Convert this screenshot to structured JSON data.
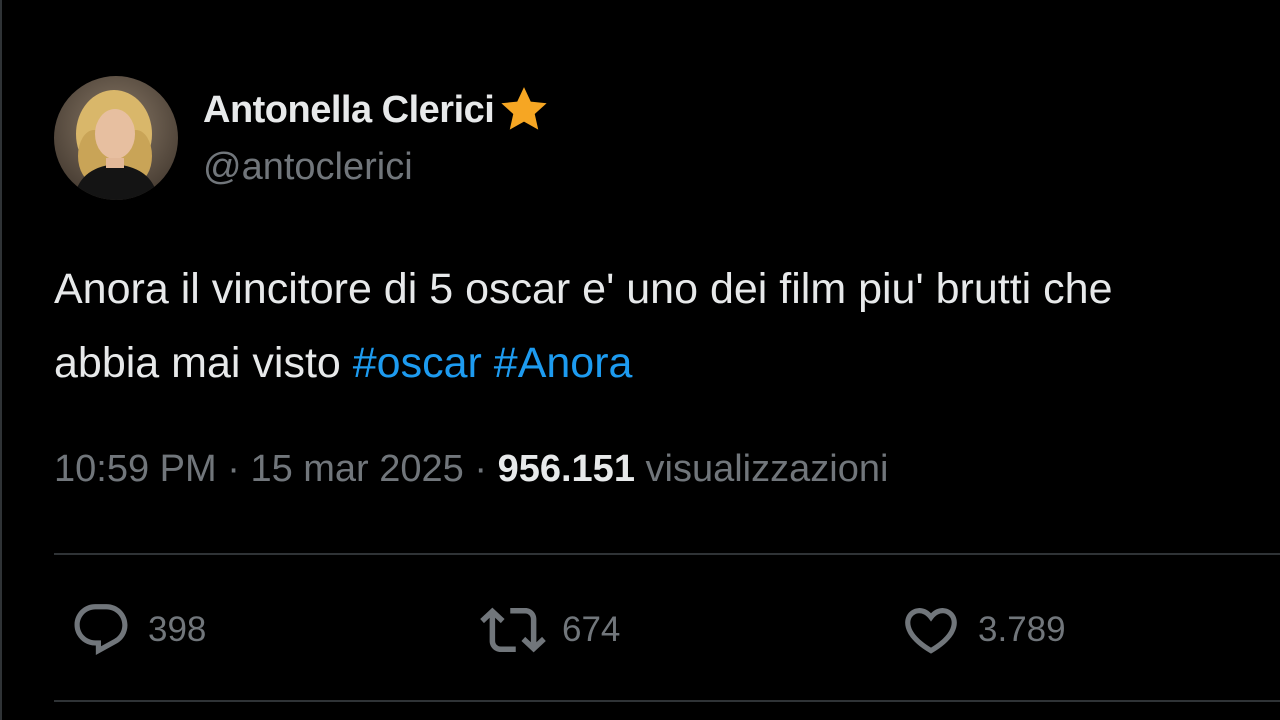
{
  "tweet": {
    "author": {
      "display_name": "Antonella Clerici",
      "handle": "@antoclerici",
      "badge_icon": "star-icon",
      "badge_color": "#f6a623"
    },
    "text_line_1": "Anora il vincitore di 5 oscar e' uno dei film piu' brutti che",
    "text_line_2": "abbia mai visto ",
    "hashtags": [
      "#oscar",
      "#Anora"
    ],
    "time": "10:59 PM",
    "separator": "·",
    "date": "15 mar 2025",
    "views_count": "956.151",
    "views_label": "visualizzazioni",
    "actions": {
      "reply": {
        "icon": "reply-bubble-icon",
        "count": "398"
      },
      "retweet": {
        "icon": "retweet-icon",
        "count": "674"
      },
      "like": {
        "icon": "heart-icon",
        "count": "3.789"
      }
    }
  },
  "colors": {
    "background": "#000000",
    "text": "#e7e9ea",
    "secondary": "#71767b",
    "link": "#1d9bf0",
    "divider": "#2f3336"
  }
}
